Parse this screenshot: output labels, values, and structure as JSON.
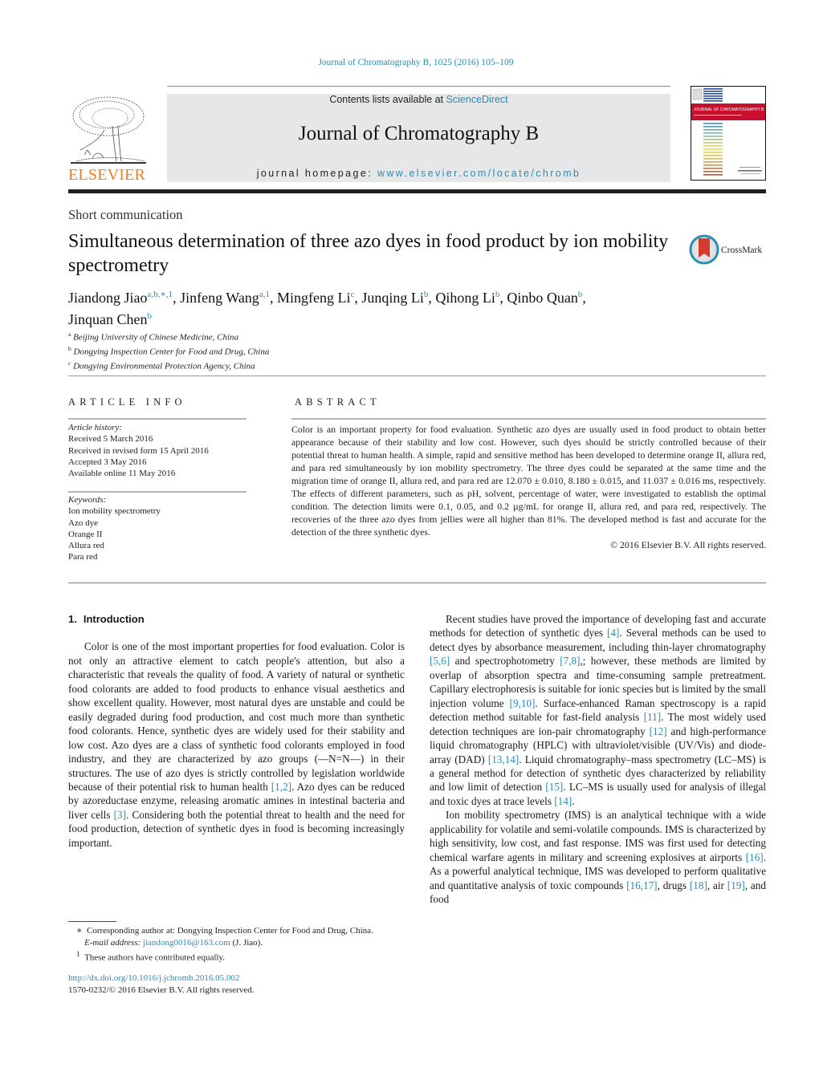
{
  "header": {
    "citation": "Journal of Chromatography B, 1025 (2016) 105–109",
    "contents_prefix": "Contents lists available at ",
    "contents_link": "ScienceDirect",
    "journal_title": "Journal of Chromatography B",
    "homepage_prefix": "journal homepage: ",
    "homepage_link": "www.elsevier.com/locate/chromb",
    "publisher_logo_text": "ELSEVIER",
    "cover_title": "JOURNAL OF CHROMATOGRAPHY B"
  },
  "colors": {
    "link": "#2a8bb5",
    "elsevier_orange": "#f07d1a",
    "banner_gray": "#e6e7e8",
    "cover_red": "#c8102e",
    "crossmark_red": "#d63b2f",
    "crossmark_blue": "#2a8bb5"
  },
  "article": {
    "type": "Short communication",
    "title": "Simultaneous determination of three azo dyes in food product by ion mobility spectrometry",
    "crossmark_label": "CrossMark",
    "authors": [
      {
        "name": "Jiandong Jiao",
        "sup": "a,b,∗,1",
        "sep": ", "
      },
      {
        "name": "Jinfeng Wang",
        "sup": "a,1",
        "sep": ", "
      },
      {
        "name": "Mingfeng Li",
        "sup": "c",
        "sep": ", "
      },
      {
        "name": "Junqing Li",
        "sup": "b",
        "sep": ", "
      },
      {
        "name": "Qihong Li",
        "sup": "b",
        "sep": ", "
      },
      {
        "name": "Qinbo Quan",
        "sup": "b",
        "sep": ", "
      },
      {
        "name": "Jinquan Chen",
        "sup": "b",
        "sep": ""
      }
    ],
    "affiliations": [
      {
        "mark": "a",
        "text": "Beijing University of Chinese Medicine, China"
      },
      {
        "mark": "b",
        "text": "Dongying Inspection Center for Food and Drug, China"
      },
      {
        "mark": "c",
        "text": "Dongying Environmental Protection Agency, China"
      }
    ]
  },
  "article_info": {
    "heading": "ARTICLE INFO",
    "history_label": "Article history:",
    "history": [
      "Received 5 March 2016",
      "Received in revised form 15 April 2016",
      "Accepted 3 May 2016",
      "Available online 11 May 2016"
    ],
    "keywords_label": "Keywords:",
    "keywords": [
      "Ion mobility spectrometry",
      "Azo dye",
      "Orange II",
      "Allura red",
      "Para red"
    ]
  },
  "abstract": {
    "heading": "ABSTRACT",
    "text": "Color is an important property for food evaluation. Synthetic azo dyes are usually used in food product to obtain better appearance because of their stability and low cost. However, such dyes should be strictly controlled because of their potential threat to human health. A simple, rapid and sensitive method has been developed to determine orange II, allura red, and para red simultaneously by ion mobility spec­trometry. The three dyes could be separated at the same time and the migration time of orange II, allura red, and para red are 12.070 ± 0.010, 8.180 ± 0.015, and 11.037 ± 0.016 ms, respectively. The effects of different parameters, such as pH, solvent, percentage of water, were investigated to establish the opti­mal condition. The detection limits were 0.1, 0.05, and 0.2 µg/mL for orange II, allura red, and para red, respectively. The recoveries of the three azo dyes from jellies were all higher than 81%. The developed method is fast and accurate for the detection of the three synthetic dyes.",
    "copyright": "© 2016 Elsevier B.V. All rights reserved."
  },
  "body": {
    "section_number": "1.",
    "section_title": "Introduction",
    "left_paragraph": [
      {
        "t": "Color is one of the most important properties for food eval­uation. Color is not only an attractive element to catch people's attention, but also a characteristic that reveals the quality of food. A variety of natural or synthetic food colorants are added to food products to enhance visual aesthetics and show excellent qual­ity. However, most natural dyes are unstable and could be easily degraded during food production, and cost much more than syn­thetic food colorants. Hence, synthetic dyes are widely used for their stability and low cost. Azo dyes are a class of synthetic food col­orants employed in food industry, and they are characterized by azo groups (—N=N—) in their structures. The use of azo dyes is strictly controlled by legislation worldwide because of their potential risk to human health "
      },
      {
        "ref": "[1,2]"
      },
      {
        "t": ". Azo dyes can be reduced by azoreductase enzyme, releasing aromatic amines in intestinal bacteria and liver cells "
      },
      {
        "ref": "[3]"
      },
      {
        "t": ". Considering both the potential threat to health and the need for food production, detection of synthetic dyes in food is becoming increasingly important."
      }
    ],
    "right_paragraph_1": [
      {
        "t": "Recent studies have proved the importance of developing fast and accurate methods for detection of synthetic dyes "
      },
      {
        "ref": "[4]"
      },
      {
        "t": ". Several methods can be used to detect dyes by absorbance measurement, including thin-layer chromatography "
      },
      {
        "ref": "[5,6]"
      },
      {
        "t": " and spectrophotometry "
      },
      {
        "ref": "[7,8]"
      },
      {
        "t": ",; however, these methods are limited by overlap of absorption spectra and time-consuming sample pretreatment. Capillary elec­trophoresis is suitable for ionic species but is limited by the small injection volume "
      },
      {
        "ref": "[9,10]"
      },
      {
        "t": ". Surface-enhanced Raman spectroscopy is a rapid detection method suitable for fast-field analysis "
      },
      {
        "ref": "[11]"
      },
      {
        "t": ". The most widely used detection techniques are ion-pair chromatog­raphy "
      },
      {
        "ref": "[12]"
      },
      {
        "t": " and high-performance liquid chromatography (HPLC) with ultraviolet/visible (UV/Vis) and diode-array (DAD) "
      },
      {
        "ref": "[13,14]"
      },
      {
        "t": ". Liquid chromatography–mass spectrometry (LC–MS) is a general method for detection of synthetic dyes characterized by reliability and low limit of detection "
      },
      {
        "ref": "[15]"
      },
      {
        "t": ". LC–MS is usually used for analysis of illegal and toxic dyes at trace levels "
      },
      {
        "ref": "[14]"
      },
      {
        "t": "."
      }
    ],
    "right_paragraph_2": [
      {
        "t": "Ion mobility spectrometry (IMS) is an analytical technique with a wide applicability for volatile and semi-volatile compounds. IMS is characterized by high sensitivity, low cost, and fast response. IMS was first used for detecting chemical warfare agents in military and screening explosives at airports "
      },
      {
        "ref": "[16]"
      },
      {
        "t": ". As a powerful analytical tech­nique, IMS was developed to perform qualitative and quantitative analysis of toxic compounds "
      },
      {
        "ref": "[16,17]"
      },
      {
        "t": ", drugs "
      },
      {
        "ref": "[18]"
      },
      {
        "t": ", air "
      },
      {
        "ref": "[19]"
      },
      {
        "t": ", and food"
      }
    ]
  },
  "footnotes": {
    "corresponding_mark": "∗",
    "corresponding_text": "Corresponding author at: Dongying Inspection Center for Food and Drug, China.",
    "email_label": "E-mail address:",
    "email": "jiandong0016@163.com",
    "email_suffix": " (J. Jiao).",
    "equal_mark": "1",
    "equal_text": "These authors have contributed equally.",
    "doi": "http://dx.doi.org/10.1016/j.jchromb.2016.05.002",
    "issn_copyright": "1570-0232/© 2016 Elsevier B.V. All rights reserved."
  }
}
